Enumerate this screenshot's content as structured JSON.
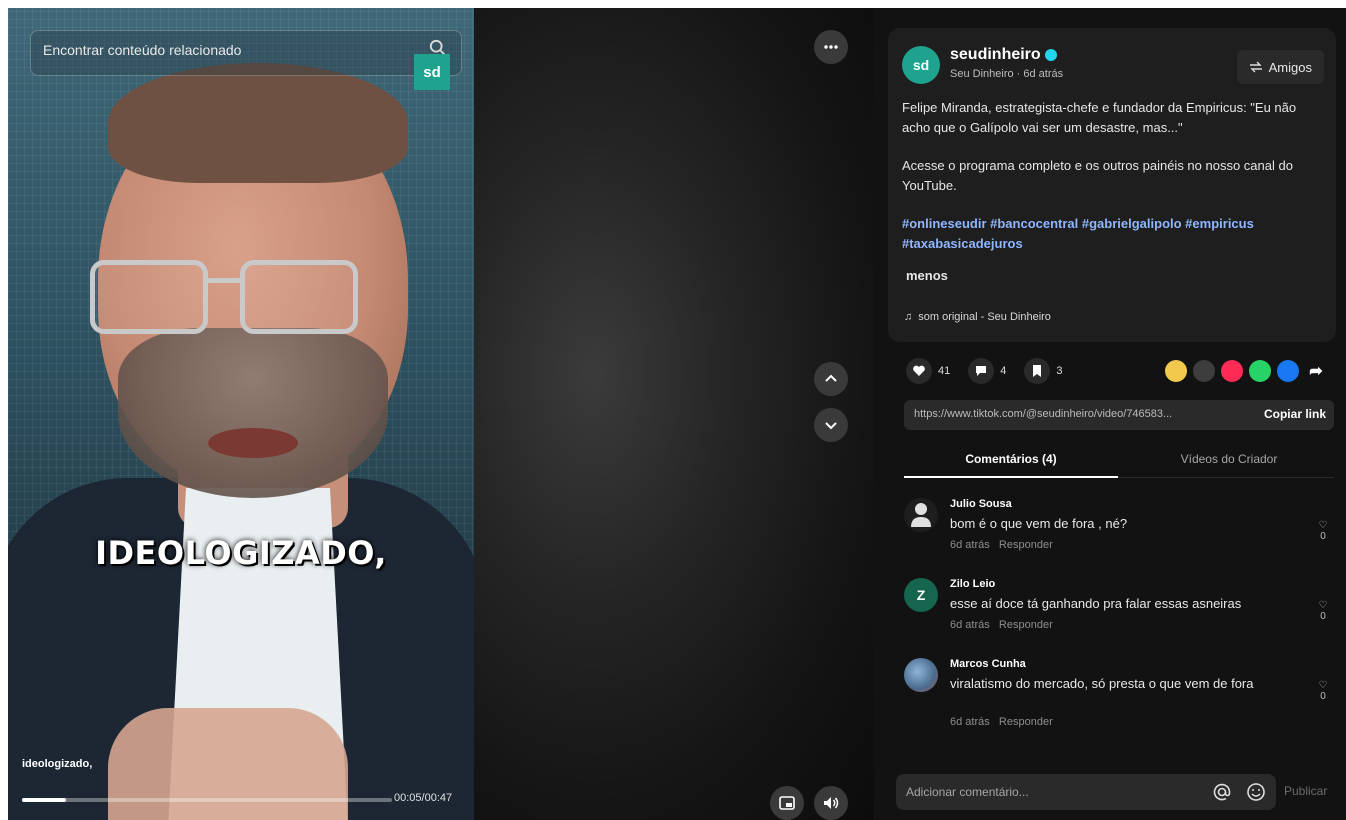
{
  "video": {
    "search_placeholder": "Encontrar conteúdo relacionado",
    "logo_text": "sd",
    "caption": "IDEOLOGIZADO,",
    "subtitle": "ideologizado,",
    "time": "00:05/00:47",
    "progress_fraction": 0.12
  },
  "post": {
    "avatar_text": "sd",
    "author": "seudinheiro",
    "author_sub": "Seu Dinheiro · 6d atrás",
    "friends_label": "Amigos",
    "description_1": "Felipe Miranda, estrategista-chefe e fundador da Empiricus: \"Eu não acho que o Galípolo vai ser um desastre, mas...\"",
    "description_2": "Acesse o programa completo e os outros painéis no nosso canal do YouTube.",
    "hashtags": "#onlineseudir #bancocentral #gabrielgalipolo #empiricus #taxabasicadejuros",
    "less_label": "menos",
    "sound": "som original - Seu Dinheiro"
  },
  "stats": {
    "likes": "41",
    "comments": "4",
    "saves": "3"
  },
  "share_colors": [
    "#f2c94c",
    "#3d3d3d",
    "#fe2c55",
    "#25d366",
    "#1877f2"
  ],
  "link": {
    "url": "https://www.tiktok.com/@seudinheiro/video/746583...",
    "copy_label": "Copiar link"
  },
  "tabs": {
    "comments": "Comentários (4)",
    "creator_videos": "Vídeos do Criador"
  },
  "comments": [
    {
      "name": "Julio Sousa",
      "text": "bom é o que vem de fora , né?",
      "date": "6d atrás",
      "reply": "Responder",
      "likes": "0",
      "avatar": "person"
    },
    {
      "name": "Zilo Leio",
      "text": "esse aí doce tá ganhando pra falar essas asneiras",
      "date": "6d atrás",
      "reply": "Responder",
      "likes": "0",
      "avatar": "Z"
    },
    {
      "name": "Marcos Cunha",
      "text": "viralatismo do mercado, só presta o que vem de fora",
      "date": "6d atrás",
      "reply": "Responder",
      "likes": "0",
      "avatar": "photo"
    }
  ],
  "composer": {
    "placeholder": "Adicionar comentário...",
    "post_label": "Publicar"
  }
}
